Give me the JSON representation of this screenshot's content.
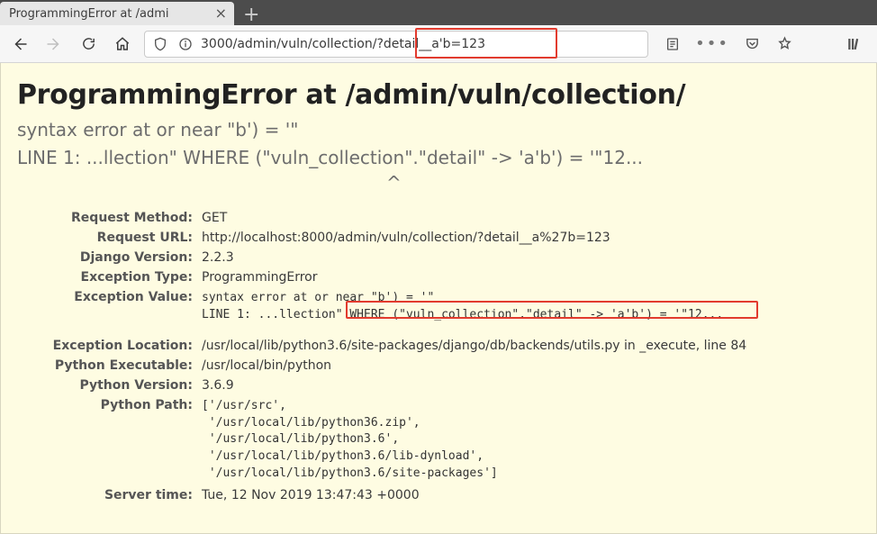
{
  "browser": {
    "tab_title": "ProgrammingError at /admi",
    "url_visible": "3000/admin/vuln/collection/?detail__a'b=123"
  },
  "page": {
    "title": "ProgrammingError at /admin/vuln/collection/",
    "subtitle_line1": "syntax error at or near \"b') = '\"",
    "subtitle_line2": "LINE 1: ...llection\" WHERE (\"vuln_collection\".\"detail\" -> 'a'b') = '\"12...",
    "caret": "^",
    "meta": {
      "request_method_label": "Request Method:",
      "request_method": "GET",
      "request_url_label": "Request URL:",
      "request_url": "http://localhost:8000/admin/vuln/collection/?detail__a%27b=123",
      "django_version_label": "Django Version:",
      "django_version": "2.2.3",
      "exception_type_label": "Exception Type:",
      "exception_type": "ProgrammingError",
      "exception_value_label": "Exception Value:",
      "exception_value": "syntax error at or near \"b') = '\"\nLINE 1: ...llection\" WHERE (\"vuln_collection\".\"detail\" -> 'a'b') = '\"12...",
      "exception_location_label": "Exception Location:",
      "exception_location": "/usr/local/lib/python3.6/site-packages/django/db/backends/utils.py in _execute, line 84",
      "python_executable_label": "Python Executable:",
      "python_executable": "/usr/local/bin/python",
      "python_version_label": "Python Version:",
      "python_version": "3.6.9",
      "python_path_label": "Python Path:",
      "python_path": "['/usr/src',\n '/usr/local/lib/python36.zip',\n '/usr/local/lib/python3.6',\n '/usr/local/lib/python3.6/lib-dynload',\n '/usr/local/lib/python3.6/site-packages']",
      "server_time_label": "Server time:",
      "server_time": "Tue, 12 Nov 2019 13:47:43 +0000"
    }
  },
  "colors": {
    "highlight": "#e23b2e",
    "page_bg": "#fefce2"
  }
}
